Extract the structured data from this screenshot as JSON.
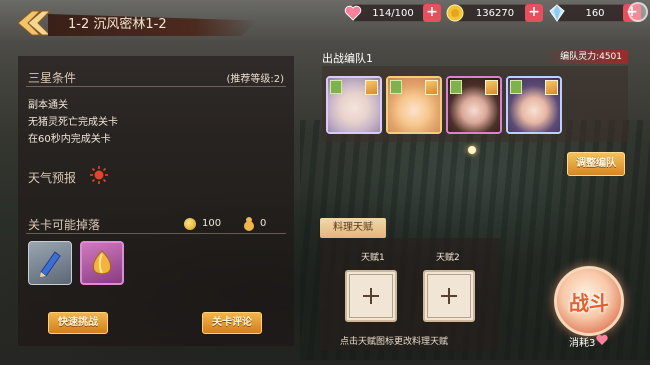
{
  "header": {
    "stage_title": "1-2 沉风密林1-2",
    "resources": [
      {
        "icon": "heart-icon",
        "value": "114/100"
      },
      {
        "icon": "coin-icon",
        "value": "136270"
      },
      {
        "icon": "crystal-icon",
        "value": "160"
      }
    ],
    "plus_label": "+"
  },
  "left_panel": {
    "star_title": "三星条件",
    "recommended_level": "(推荐等级:2)",
    "conditions": [
      "副本通关",
      "无猪灵死亡完成关卡",
      "在60秒内完成关卡"
    ],
    "weather_label": "天气预报",
    "drops_title": "关卡可能掉落",
    "coin_drop": "100",
    "item_drop": "0",
    "quick_challenge": "快速挑战",
    "stage_review": "关卡评论"
  },
  "team": {
    "label": "出战编队1",
    "power": "编队灵力:4501",
    "adjust_button": "调整编队",
    "heroes": [
      "hero-1",
      "hero-2",
      "hero-3",
      "hero-4"
    ]
  },
  "cooking": {
    "tab_label": "料理天赋",
    "talent1": "天赋1",
    "talent2": "天赋2",
    "hint": "点击天赋图标更改料理天赋"
  },
  "battle": {
    "label": "战斗",
    "cost": "消耗3"
  },
  "colors": {
    "accent_orange": "#d68722",
    "plus_red": "#e5505c",
    "power_red": "#9e2a2a"
  }
}
